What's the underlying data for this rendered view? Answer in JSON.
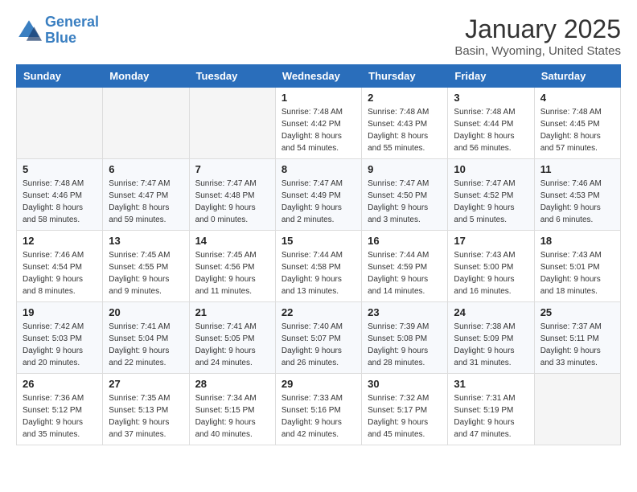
{
  "header": {
    "logo_line1": "General",
    "logo_line2": "Blue",
    "title": "January 2025",
    "subtitle": "Basin, Wyoming, United States"
  },
  "weekdays": [
    "Sunday",
    "Monday",
    "Tuesday",
    "Wednesday",
    "Thursday",
    "Friday",
    "Saturday"
  ],
  "weeks": [
    [
      {
        "day": "",
        "sunrise": "",
        "sunset": "",
        "daylight": ""
      },
      {
        "day": "",
        "sunrise": "",
        "sunset": "",
        "daylight": ""
      },
      {
        "day": "",
        "sunrise": "",
        "sunset": "",
        "daylight": ""
      },
      {
        "day": "1",
        "sunrise": "Sunrise: 7:48 AM",
        "sunset": "Sunset: 4:42 PM",
        "daylight": "Daylight: 8 hours and 54 minutes."
      },
      {
        "day": "2",
        "sunrise": "Sunrise: 7:48 AM",
        "sunset": "Sunset: 4:43 PM",
        "daylight": "Daylight: 8 hours and 55 minutes."
      },
      {
        "day": "3",
        "sunrise": "Sunrise: 7:48 AM",
        "sunset": "Sunset: 4:44 PM",
        "daylight": "Daylight: 8 hours and 56 minutes."
      },
      {
        "day": "4",
        "sunrise": "Sunrise: 7:48 AM",
        "sunset": "Sunset: 4:45 PM",
        "daylight": "Daylight: 8 hours and 57 minutes."
      }
    ],
    [
      {
        "day": "5",
        "sunrise": "Sunrise: 7:48 AM",
        "sunset": "Sunset: 4:46 PM",
        "daylight": "Daylight: 8 hours and 58 minutes."
      },
      {
        "day": "6",
        "sunrise": "Sunrise: 7:47 AM",
        "sunset": "Sunset: 4:47 PM",
        "daylight": "Daylight: 8 hours and 59 minutes."
      },
      {
        "day": "7",
        "sunrise": "Sunrise: 7:47 AM",
        "sunset": "Sunset: 4:48 PM",
        "daylight": "Daylight: 9 hours and 0 minutes."
      },
      {
        "day": "8",
        "sunrise": "Sunrise: 7:47 AM",
        "sunset": "Sunset: 4:49 PM",
        "daylight": "Daylight: 9 hours and 2 minutes."
      },
      {
        "day": "9",
        "sunrise": "Sunrise: 7:47 AM",
        "sunset": "Sunset: 4:50 PM",
        "daylight": "Daylight: 9 hours and 3 minutes."
      },
      {
        "day": "10",
        "sunrise": "Sunrise: 7:47 AM",
        "sunset": "Sunset: 4:52 PM",
        "daylight": "Daylight: 9 hours and 5 minutes."
      },
      {
        "day": "11",
        "sunrise": "Sunrise: 7:46 AM",
        "sunset": "Sunset: 4:53 PM",
        "daylight": "Daylight: 9 hours and 6 minutes."
      }
    ],
    [
      {
        "day": "12",
        "sunrise": "Sunrise: 7:46 AM",
        "sunset": "Sunset: 4:54 PM",
        "daylight": "Daylight: 9 hours and 8 minutes."
      },
      {
        "day": "13",
        "sunrise": "Sunrise: 7:45 AM",
        "sunset": "Sunset: 4:55 PM",
        "daylight": "Daylight: 9 hours and 9 minutes."
      },
      {
        "day": "14",
        "sunrise": "Sunrise: 7:45 AM",
        "sunset": "Sunset: 4:56 PM",
        "daylight": "Daylight: 9 hours and 11 minutes."
      },
      {
        "day": "15",
        "sunrise": "Sunrise: 7:44 AM",
        "sunset": "Sunset: 4:58 PM",
        "daylight": "Daylight: 9 hours and 13 minutes."
      },
      {
        "day": "16",
        "sunrise": "Sunrise: 7:44 AM",
        "sunset": "Sunset: 4:59 PM",
        "daylight": "Daylight: 9 hours and 14 minutes."
      },
      {
        "day": "17",
        "sunrise": "Sunrise: 7:43 AM",
        "sunset": "Sunset: 5:00 PM",
        "daylight": "Daylight: 9 hours and 16 minutes."
      },
      {
        "day": "18",
        "sunrise": "Sunrise: 7:43 AM",
        "sunset": "Sunset: 5:01 PM",
        "daylight": "Daylight: 9 hours and 18 minutes."
      }
    ],
    [
      {
        "day": "19",
        "sunrise": "Sunrise: 7:42 AM",
        "sunset": "Sunset: 5:03 PM",
        "daylight": "Daylight: 9 hours and 20 minutes."
      },
      {
        "day": "20",
        "sunrise": "Sunrise: 7:41 AM",
        "sunset": "Sunset: 5:04 PM",
        "daylight": "Daylight: 9 hours and 22 minutes."
      },
      {
        "day": "21",
        "sunrise": "Sunrise: 7:41 AM",
        "sunset": "Sunset: 5:05 PM",
        "daylight": "Daylight: 9 hours and 24 minutes."
      },
      {
        "day": "22",
        "sunrise": "Sunrise: 7:40 AM",
        "sunset": "Sunset: 5:07 PM",
        "daylight": "Daylight: 9 hours and 26 minutes."
      },
      {
        "day": "23",
        "sunrise": "Sunrise: 7:39 AM",
        "sunset": "Sunset: 5:08 PM",
        "daylight": "Daylight: 9 hours and 28 minutes."
      },
      {
        "day": "24",
        "sunrise": "Sunrise: 7:38 AM",
        "sunset": "Sunset: 5:09 PM",
        "daylight": "Daylight: 9 hours and 31 minutes."
      },
      {
        "day": "25",
        "sunrise": "Sunrise: 7:37 AM",
        "sunset": "Sunset: 5:11 PM",
        "daylight": "Daylight: 9 hours and 33 minutes."
      }
    ],
    [
      {
        "day": "26",
        "sunrise": "Sunrise: 7:36 AM",
        "sunset": "Sunset: 5:12 PM",
        "daylight": "Daylight: 9 hours and 35 minutes."
      },
      {
        "day": "27",
        "sunrise": "Sunrise: 7:35 AM",
        "sunset": "Sunset: 5:13 PM",
        "daylight": "Daylight: 9 hours and 37 minutes."
      },
      {
        "day": "28",
        "sunrise": "Sunrise: 7:34 AM",
        "sunset": "Sunset: 5:15 PM",
        "daylight": "Daylight: 9 hours and 40 minutes."
      },
      {
        "day": "29",
        "sunrise": "Sunrise: 7:33 AM",
        "sunset": "Sunset: 5:16 PM",
        "daylight": "Daylight: 9 hours and 42 minutes."
      },
      {
        "day": "30",
        "sunrise": "Sunrise: 7:32 AM",
        "sunset": "Sunset: 5:17 PM",
        "daylight": "Daylight: 9 hours and 45 minutes."
      },
      {
        "day": "31",
        "sunrise": "Sunrise: 7:31 AM",
        "sunset": "Sunset: 5:19 PM",
        "daylight": "Daylight: 9 hours and 47 minutes."
      },
      {
        "day": "",
        "sunrise": "",
        "sunset": "",
        "daylight": ""
      }
    ]
  ]
}
